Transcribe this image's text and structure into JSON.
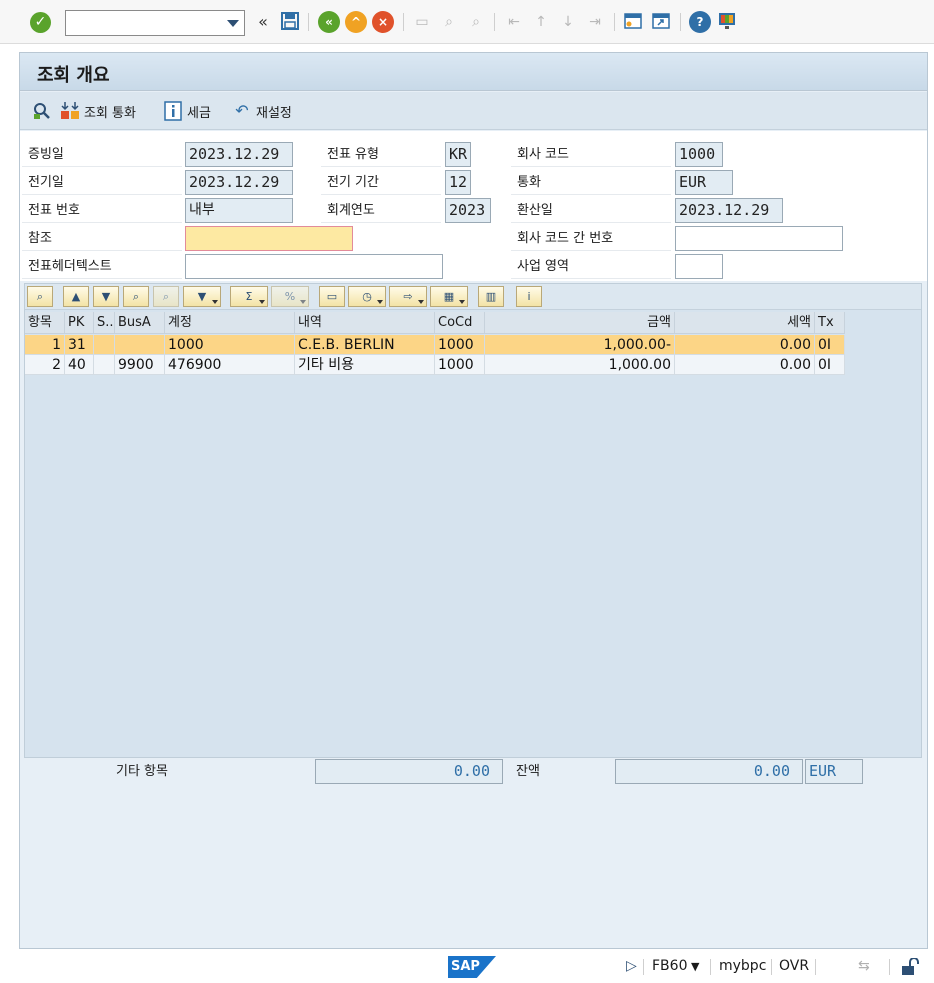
{
  "window": {
    "title": "조회 개요"
  },
  "system_toolbar": {
    "command_field_value": "",
    "icons": [
      "enter-icon",
      "back-double-icon",
      "save-icon",
      "back-icon",
      "exit-icon",
      "cancel-icon",
      "print-icon",
      "find-icon",
      "find-next-icon",
      "first-page-icon",
      "prev-page-icon",
      "next-page-icon",
      "last-page-icon",
      "new-session-icon",
      "shortcut-icon",
      "help-icon",
      "customize-layout-icon"
    ]
  },
  "app_toolbar": {
    "items": [
      {
        "label": "",
        "icon": "display-icon"
      },
      {
        "label": "조회 통화",
        "icon": "currency-icon"
      },
      {
        "label": "세금",
        "icon": "info-icon"
      },
      {
        "label": "재설정",
        "icon": "reset-icon"
      }
    ]
  },
  "form": {
    "doc_date": {
      "label": "증빙일",
      "value": "2023.12.29"
    },
    "posting_date": {
      "label": "전기일",
      "value": "2023.12.29"
    },
    "doc_number": {
      "label": "전표 번호",
      "value": "내부"
    },
    "reference": {
      "label": "참조",
      "value": ""
    },
    "header_text": {
      "label": "전표헤더텍스트",
      "value": ""
    },
    "doc_type": {
      "label": "전표 유형",
      "value": "KR"
    },
    "period": {
      "label": "전기 기간",
      "value": "12"
    },
    "fiscal_year": {
      "label": "회계연도",
      "value": "2023"
    },
    "company_code": {
      "label": "회사 코드",
      "value": "1000"
    },
    "currency": {
      "label": "통화",
      "value": "EUR"
    },
    "translation_date": {
      "label": "환산일",
      "value": "2023.12.29"
    },
    "cross_cc": {
      "label": "회사 코드 간 번호",
      "value": ""
    },
    "business_area": {
      "label": "사업 영역",
      "value": ""
    }
  },
  "table": {
    "columns": [
      "항목",
      "PK",
      "S...",
      "BusA",
      "계정",
      "내역",
      "CoCd",
      "금액",
      "세액",
      "Tx"
    ],
    "rows": [
      {
        "item": "1",
        "pk": "31",
        "s": "",
        "busa": "",
        "account": "1000",
        "desc": "C.E.B. BERLIN",
        "cocd": "1000",
        "amount": "1,000.00-",
        "tax": "0.00",
        "tx": "0I"
      },
      {
        "item": "2",
        "pk": "40",
        "s": "",
        "busa": "9900",
        "account": "476900",
        "desc": "기타 비용",
        "cocd": "1000",
        "amount": "1,000.00",
        "tax": "0.00",
        "tx": "0I"
      }
    ]
  },
  "totals": {
    "other_items_label": "기타 항목",
    "other_items_value": "0.00",
    "balance_label": "잔액",
    "balance_value": "0.00",
    "balance_currency": "EUR"
  },
  "status_bar": {
    "logo": "SAP",
    "transaction": "FB60",
    "system": "mybpc",
    "mode": "OVR"
  }
}
